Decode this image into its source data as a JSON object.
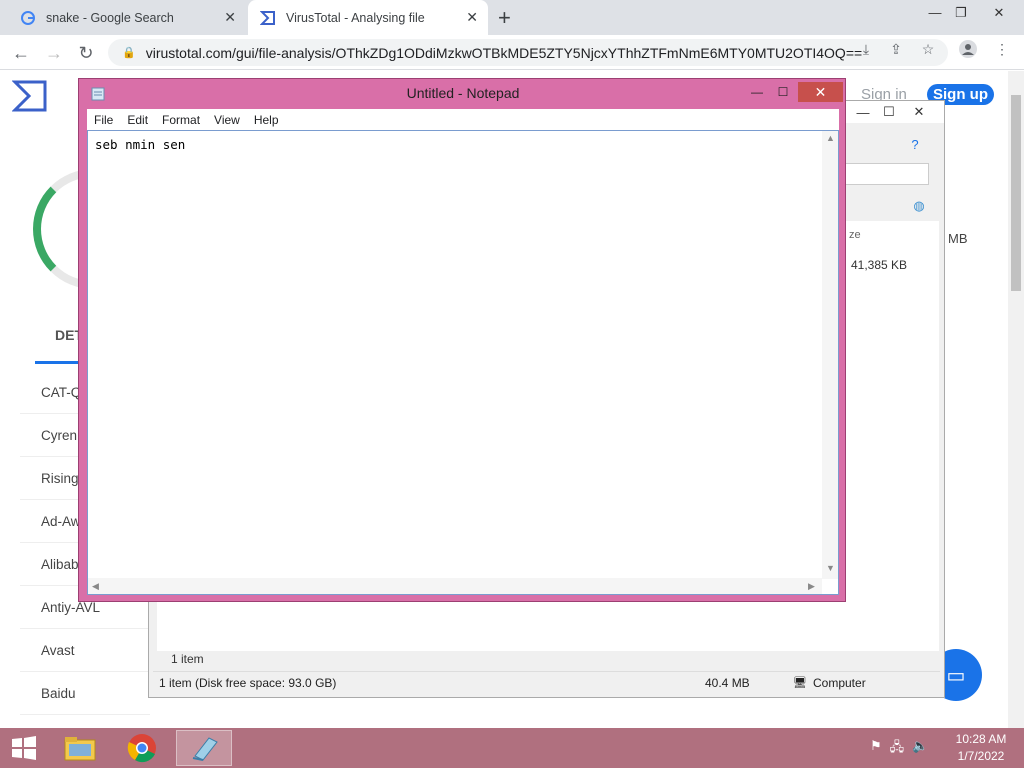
{
  "browser": {
    "tabs": [
      {
        "title": "snake - Google Search"
      },
      {
        "title": "VirusTotal - Analysing file"
      }
    ],
    "url": "virustotal.com/gui/file-analysis/OThkZDg1ODdiMzkwOTBkMDE5ZTY5NjcxYThhZTFmNmE6MTY0MTU2OTI4OQ=="
  },
  "virustotal": {
    "sign_in": "Sign in",
    "sign_up": "Sign up",
    "detection_tab": "DET",
    "engines": [
      "CAT-Q",
      "Cyren",
      "Rising",
      "Ad-Aw",
      "Alibab",
      "Antiy-AVL",
      "Avast",
      "Baidu"
    ],
    "size_fragment": "MB"
  },
  "explorer": {
    "size_column": "ze",
    "file_size": "41,385 KB",
    "item_count": "1 item",
    "status_left": "1 item (Disk free space: 93.0 GB)",
    "status_size": "40.4 MB",
    "status_location": "Computer"
  },
  "notepad": {
    "title": "Untitled - Notepad",
    "menu": [
      "File",
      "Edit",
      "Format",
      "View",
      "Help"
    ],
    "content": "seb nmin sen"
  },
  "taskbar": {
    "time": "10:28 AM",
    "date": "1/7/2022"
  },
  "colors": {
    "notepad_frame": "#d96fa8",
    "taskbar": "#b0707f",
    "vt_blue": "#1a73e8"
  }
}
